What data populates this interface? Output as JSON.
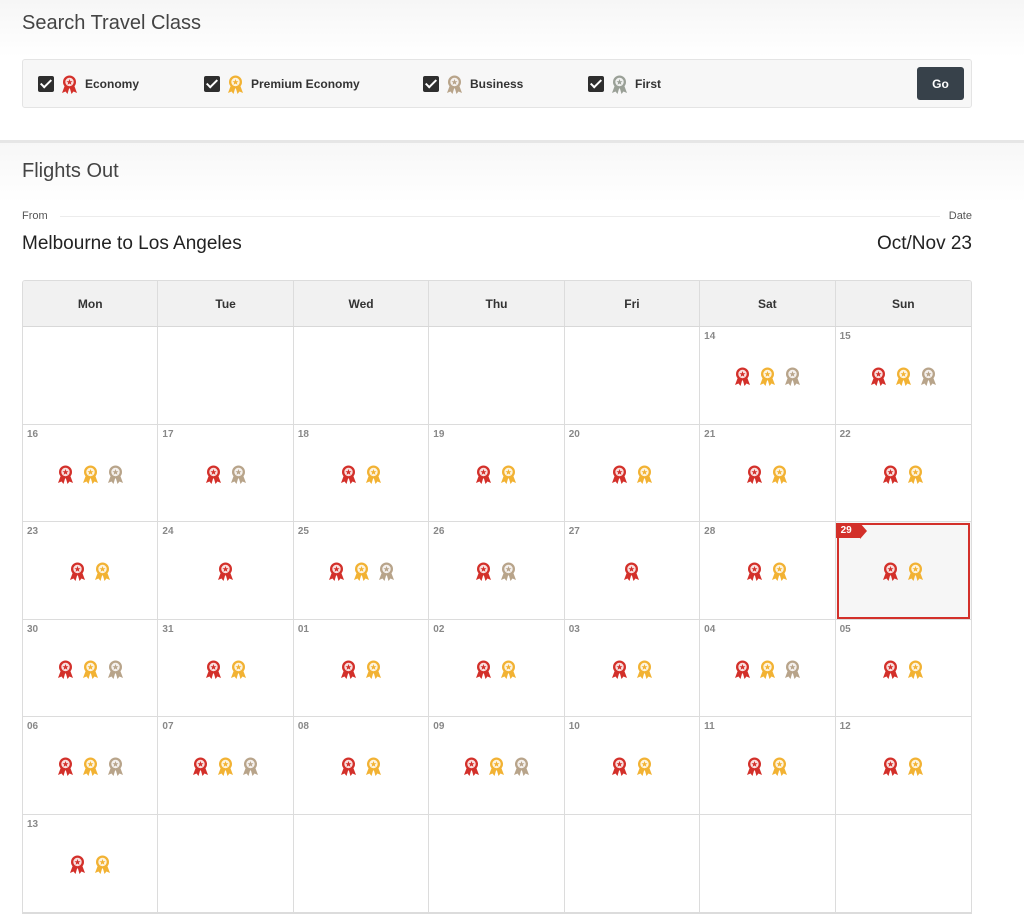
{
  "search": {
    "title": "Search Travel Class",
    "go_label": "Go",
    "classes": [
      {
        "label": "Economy",
        "icon": "economy-award-icon",
        "color": "#d3302a",
        "checked": true
      },
      {
        "label": "Premium Economy",
        "icon": "premium-economy-award-icon",
        "color": "#f2b233",
        "checked": true
      },
      {
        "label": "Business",
        "icon": "business-award-icon",
        "color": "#b8a48a",
        "checked": true
      },
      {
        "label": "First",
        "icon": "first-award-icon",
        "color": "#9aa097",
        "checked": true
      }
    ]
  },
  "flights": {
    "title": "Flights Out",
    "from_label": "From",
    "date_label": "Date",
    "route": "Melbourne to Los Angeles",
    "period": "Oct/Nov 23"
  },
  "calendar": {
    "weekdays": [
      "Mon",
      "Tue",
      "Wed",
      "Thu",
      "Fri",
      "Sat",
      "Sun"
    ],
    "award_colors": {
      "E": "#d3302a",
      "P": "#f2b233",
      "B": "#b8a48a"
    },
    "selected_day": "29",
    "cells": [
      {
        "day": "",
        "awards": []
      },
      {
        "day": "",
        "awards": []
      },
      {
        "day": "",
        "awards": []
      },
      {
        "day": "",
        "awards": []
      },
      {
        "day": "",
        "awards": []
      },
      {
        "day": "14",
        "awards": [
          "E",
          "P",
          "B"
        ]
      },
      {
        "day": "15",
        "awards": [
          "E",
          "P",
          "B"
        ]
      },
      {
        "day": "16",
        "awards": [
          "E",
          "P",
          "B"
        ]
      },
      {
        "day": "17",
        "awards": [
          "E",
          "B"
        ]
      },
      {
        "day": "18",
        "awards": [
          "E",
          "P"
        ]
      },
      {
        "day": "19",
        "awards": [
          "E",
          "P"
        ]
      },
      {
        "day": "20",
        "awards": [
          "E",
          "P"
        ]
      },
      {
        "day": "21",
        "awards": [
          "E",
          "P"
        ]
      },
      {
        "day": "22",
        "awards": [
          "E",
          "P"
        ]
      },
      {
        "day": "23",
        "awards": [
          "E",
          "P"
        ]
      },
      {
        "day": "24",
        "awards": [
          "E"
        ]
      },
      {
        "day": "25",
        "awards": [
          "E",
          "P",
          "B"
        ]
      },
      {
        "day": "26",
        "awards": [
          "E",
          "B"
        ]
      },
      {
        "day": "27",
        "awards": [
          "E"
        ]
      },
      {
        "day": "28",
        "awards": [
          "E",
          "P"
        ]
      },
      {
        "day": "29",
        "awards": [
          "E",
          "P"
        ]
      },
      {
        "day": "30",
        "awards": [
          "E",
          "P",
          "B"
        ]
      },
      {
        "day": "31",
        "awards": [
          "E",
          "P"
        ]
      },
      {
        "day": "01",
        "awards": [
          "E",
          "P"
        ]
      },
      {
        "day": "02",
        "awards": [
          "E",
          "P"
        ]
      },
      {
        "day": "03",
        "awards": [
          "E",
          "P"
        ]
      },
      {
        "day": "04",
        "awards": [
          "E",
          "P",
          "B"
        ]
      },
      {
        "day": "05",
        "awards": [
          "E",
          "P"
        ]
      },
      {
        "day": "06",
        "awards": [
          "E",
          "P",
          "B"
        ]
      },
      {
        "day": "07",
        "awards": [
          "E",
          "P",
          "B"
        ]
      },
      {
        "day": "08",
        "awards": [
          "E",
          "P"
        ]
      },
      {
        "day": "09",
        "awards": [
          "E",
          "P",
          "B"
        ]
      },
      {
        "day": "10",
        "awards": [
          "E",
          "P"
        ]
      },
      {
        "day": "11",
        "awards": [
          "E",
          "P"
        ]
      },
      {
        "day": "12",
        "awards": [
          "E",
          "P"
        ]
      },
      {
        "day": "13",
        "awards": [
          "E",
          "P"
        ]
      },
      {
        "day": "",
        "awards": []
      },
      {
        "day": "",
        "awards": []
      },
      {
        "day": "",
        "awards": []
      },
      {
        "day": "",
        "awards": []
      },
      {
        "day": "",
        "awards": []
      },
      {
        "day": "",
        "awards": []
      }
    ]
  }
}
